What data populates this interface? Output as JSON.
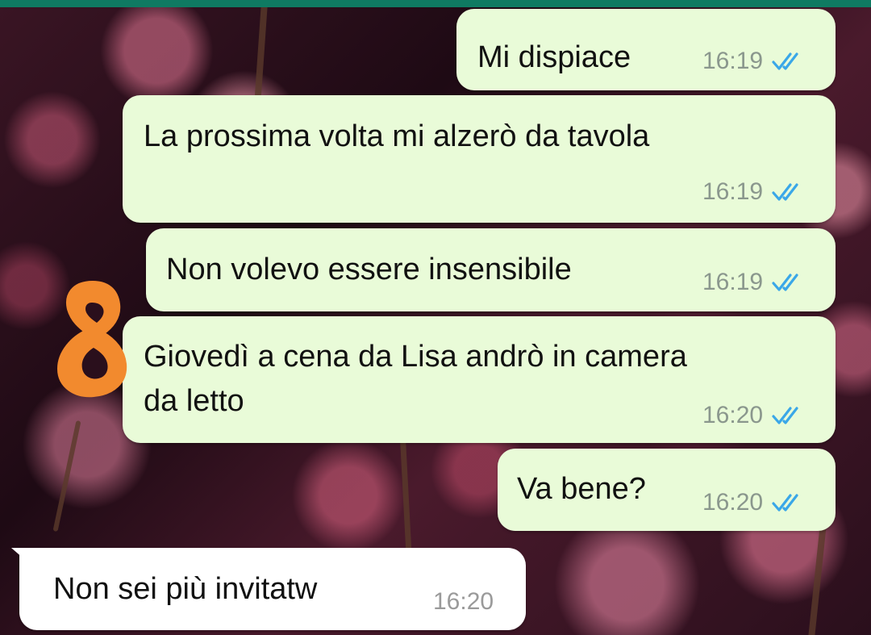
{
  "messages": [
    {
      "text": "Mi dispiace",
      "time": "16:19",
      "direction": "outgoing",
      "status": "read-ticks-icon"
    },
    {
      "text": "La prossima volta mi alzerò da tavola",
      "time": "16:19",
      "direction": "outgoing",
      "status": "read-ticks-icon"
    },
    {
      "text": "Non volevo essere insensibile",
      "time": "16:19",
      "direction": "outgoing",
      "status": "read-ticks-icon"
    },
    {
      "text_line1": "Giovedì a cena da Lisa andrò in camera",
      "text_line2": "da letto",
      "time": "16:20",
      "direction": "outgoing",
      "status": "read-ticks-icon"
    },
    {
      "text": "Va bene?",
      "time": "16:20",
      "direction": "outgoing",
      "status": "read-ticks-icon"
    },
    {
      "text": "Non sei più invitatw",
      "time": "16:20",
      "direction": "incoming"
    }
  ],
  "annotation": {
    "mark": "8",
    "color": "#f28a2e"
  },
  "colors": {
    "outgoing_bubble": "#e9fbd8",
    "incoming_bubble": "#ffffff",
    "tick_read": "#3aa7e8",
    "header": "#0f7a62"
  }
}
